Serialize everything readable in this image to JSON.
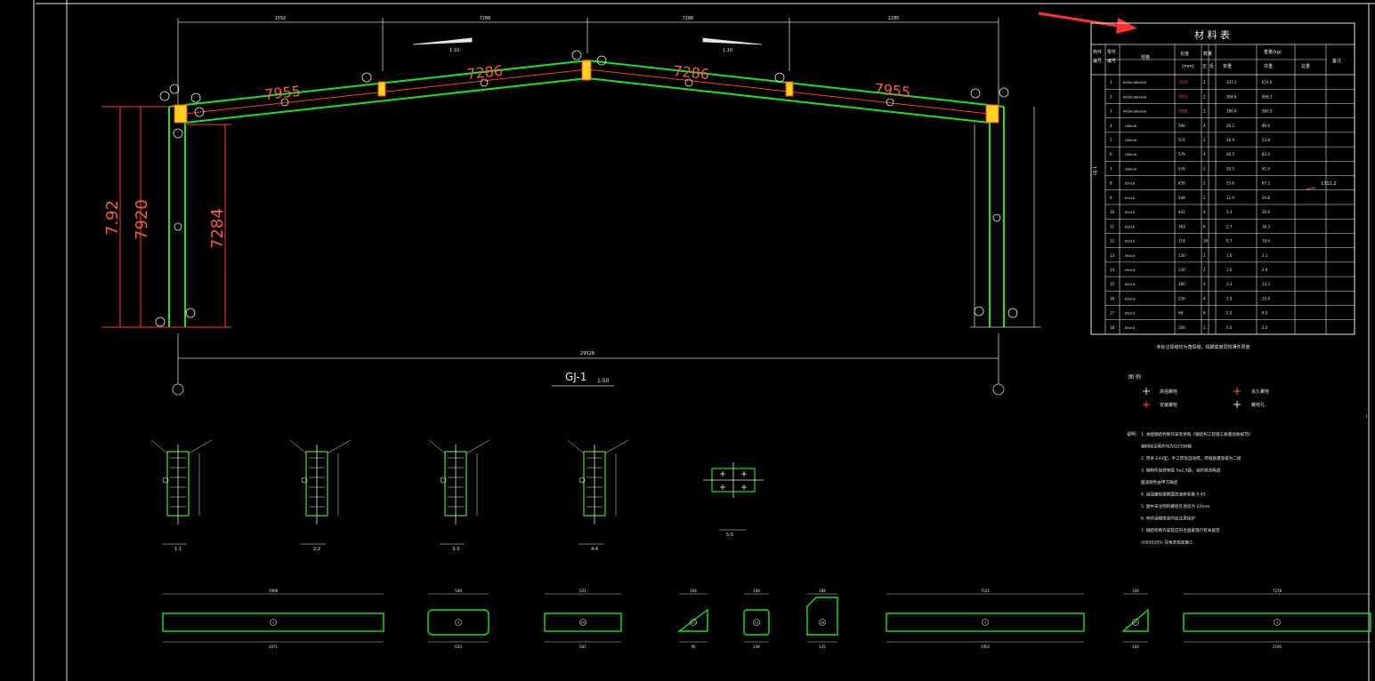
{
  "drawing": {
    "frame_label": "GJ-1",
    "frame_scale": "1:50",
    "span_dims_top": [
      "1550",
      "7286",
      "7286",
      "2285"
    ],
    "rafter_lengths": [
      "7955",
      "7286",
      "7286",
      "7955"
    ],
    "column_dims": [
      "7.92",
      "7920",
      "7284"
    ],
    "span_total": "29528",
    "slope_left": "1:10",
    "slope_right": "1:10"
  },
  "materials_table": {
    "title": "材   料   表",
    "header": {
      "member": "构件编号",
      "part": "零件编号",
      "spec": "规格",
      "length": "长度(mm)",
      "qty": "数量",
      "qty_sub": [
        "正",
        "反"
      ],
      "weight": "重量(kg)",
      "weight_sub": [
        "单重",
        "共重"
      ],
      "total": "总重",
      "note": "备注"
    },
    "member_id": "GJ-1",
    "total_value": "1311.2",
    "rows": [
      {
        "no": "1",
        "spec": "H450x180x6x8",
        "len": "7920",
        "q": "2",
        "unit": "337.3",
        "sum": "674.6"
      },
      {
        "no": "2",
        "spec": "H450x180x6x8",
        "len": "7955",
        "q": "2",
        "unit": "304.6",
        "sum": "609.1"
      },
      {
        "no": "3",
        "spec": "H450x180x6x8",
        "len": "7286",
        "q": "2",
        "unit": "280.4",
        "sum": "560.9"
      },
      {
        "no": "4",
        "spec": "-280x16",
        "len": "590",
        "q": "4",
        "unit": "20.2",
        "sum": "80.6"
      },
      {
        "no": "5",
        "spec": "-280x16",
        "len": "574",
        "q": "2",
        "unit": "26.9",
        "sum": "53.8"
      },
      {
        "no": "6",
        "spec": "-280x16",
        "len": "579",
        "q": "4",
        "unit": "20.5",
        "sum": "82.0"
      },
      {
        "no": "7",
        "spec": "-280x16",
        "len": "576",
        "q": "2",
        "unit": "20.5",
        "sum": "41.0"
      },
      {
        "no": "8",
        "spec": "-85x10",
        "len": "439",
        "q": "2",
        "unit": "33.6",
        "sum": "67.2"
      },
      {
        "no": "9",
        "spec": "-85x10",
        "len": "548",
        "q": "2",
        "unit": "12.4",
        "sum": "24.8"
      },
      {
        "no": "10",
        "spec": "-85x10",
        "len": "442",
        "q": "4",
        "unit": "5.3",
        "sum": "20.9"
      },
      {
        "no": "11",
        "spec": "-85x10",
        "len": "163",
        "q": "8",
        "unit": "2.7",
        "sum": "16.3"
      },
      {
        "no": "12",
        "spec": "-85x10",
        "len": "118",
        "q": "16",
        "unit": "0.7",
        "sum": "10.6"
      },
      {
        "no": "13",
        "spec": "-90x10",
        "len": "130",
        "q": "2",
        "unit": "1.0",
        "sum": "2.1"
      },
      {
        "no": "14",
        "spec": "-90x10",
        "len": "130",
        "q": "2",
        "unit": "1.0",
        "sum": "2.0"
      },
      {
        "no": "15",
        "spec": "-85x10",
        "len": "280",
        "q": "4",
        "unit": "3.3",
        "sum": "13.2"
      },
      {
        "no": "16",
        "spec": "-85x10",
        "len": "230",
        "q": "4",
        "unit": "3.9",
        "sum": "15.4"
      },
      {
        "no": "17",
        "spec": "-85x10",
        "len": "68",
        "q": "8",
        "unit": "1.0",
        "sum": "8.0"
      },
      {
        "no": "18",
        "spec": "-85x10",
        "len": "100",
        "q": "2",
        "unit": "1.0",
        "sum": "2.0"
      }
    ],
    "footnote": "未标注焊缝均为角焊缝，焊脚高度同较薄件厚度",
    "weights_highlighted": [
      "7920",
      "7955",
      "7286"
    ]
  },
  "legend": {
    "title": "图 例",
    "items": [
      "高强螺栓",
      "安装螺栓",
      "永久螺栓",
      "螺栓孔"
    ]
  },
  "notes": {
    "title": "说明：",
    "lines": [
      "1. 本图钢结构制作安装参照《钢结构工程施工质量验收规范》",
      "   钢材除注明外均为Q235B钢",
      "2. 焊条 E43型，手工焊及自动焊，焊缝质量等级为二级",
      "3. 钢构件除锈等级 Sa2.5级，涂防锈漆两道",
      "   面漆颜色由甲方确定",
      "4. 高强螺栓摩擦面抗滑移系数 0.45",
      "5. 图中未注明的螺栓孔径均为 22mm",
      "6. 构件运输安装时应注意保护",
      "7. 钢结构制作安装应符合国家现行有关规范",
      "   (GB50205) 及有关规定施工"
    ]
  },
  "sections": [
    "1-1",
    "2-2",
    "3-3",
    "4-4",
    "5-5"
  ],
  "parts": [
    {
      "id": "1",
      "dim_top": "1908",
      "dim_bottom": "2071"
    },
    {
      "id": "9",
      "dim_top": "508",
      "dim_bottom": "620"
    },
    {
      "id": "10",
      "dim_top": "621",
      "dim_bottom": "641"
    },
    {
      "id": "11",
      "dim_top": "104",
      "dim_bottom": "90"
    },
    {
      "id": "12",
      "dim_top": "108",
      "dim_bottom": "108"
    },
    {
      "id": "16",
      "dim_top": "189",
      "dim_bottom": "125"
    },
    {
      "id": "2",
      "dim_top": "7142",
      "dim_bottom": "1952"
    },
    {
      "id": "17",
      "dim_top": "100",
      "dim_bottom": "100"
    },
    {
      "id": "3",
      "dim_top": "7278",
      "dim_bottom": "1195"
    }
  ],
  "colors": {
    "background": "#000000",
    "member": "#19e619",
    "red": "#ff3c1e",
    "yellow": "#ffd21e",
    "line": "#e6e6e6",
    "arrow": "#ff3030"
  }
}
